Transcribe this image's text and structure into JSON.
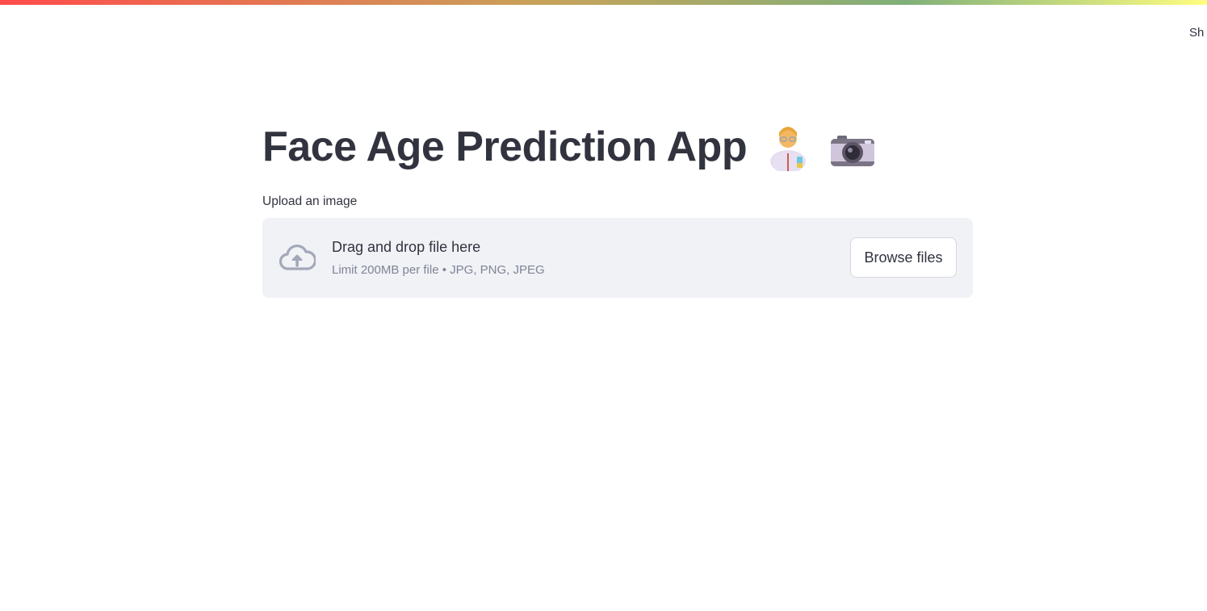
{
  "header": {
    "menu_text_visible": "Sh"
  },
  "main": {
    "title": "Face Age Prediction App",
    "title_icons": [
      "scientist-icon",
      "camera-icon"
    ],
    "uploader": {
      "label": "Upload an image",
      "instructions": "Drag and drop file here",
      "limit_text": "Limit 200MB per file • JPG, PNG, JPEG",
      "button_label": "Browse files",
      "icon": "cloud-upload-icon"
    }
  },
  "colors": {
    "text": "#31333f",
    "muted_text": "#808495",
    "dropzone_bg": "#f0f2f6",
    "button_border": "#d5d7de",
    "icon_color": "#a3a8b8",
    "decoration_start": "#ff4b4b",
    "decoration_end": "#fffd80"
  }
}
